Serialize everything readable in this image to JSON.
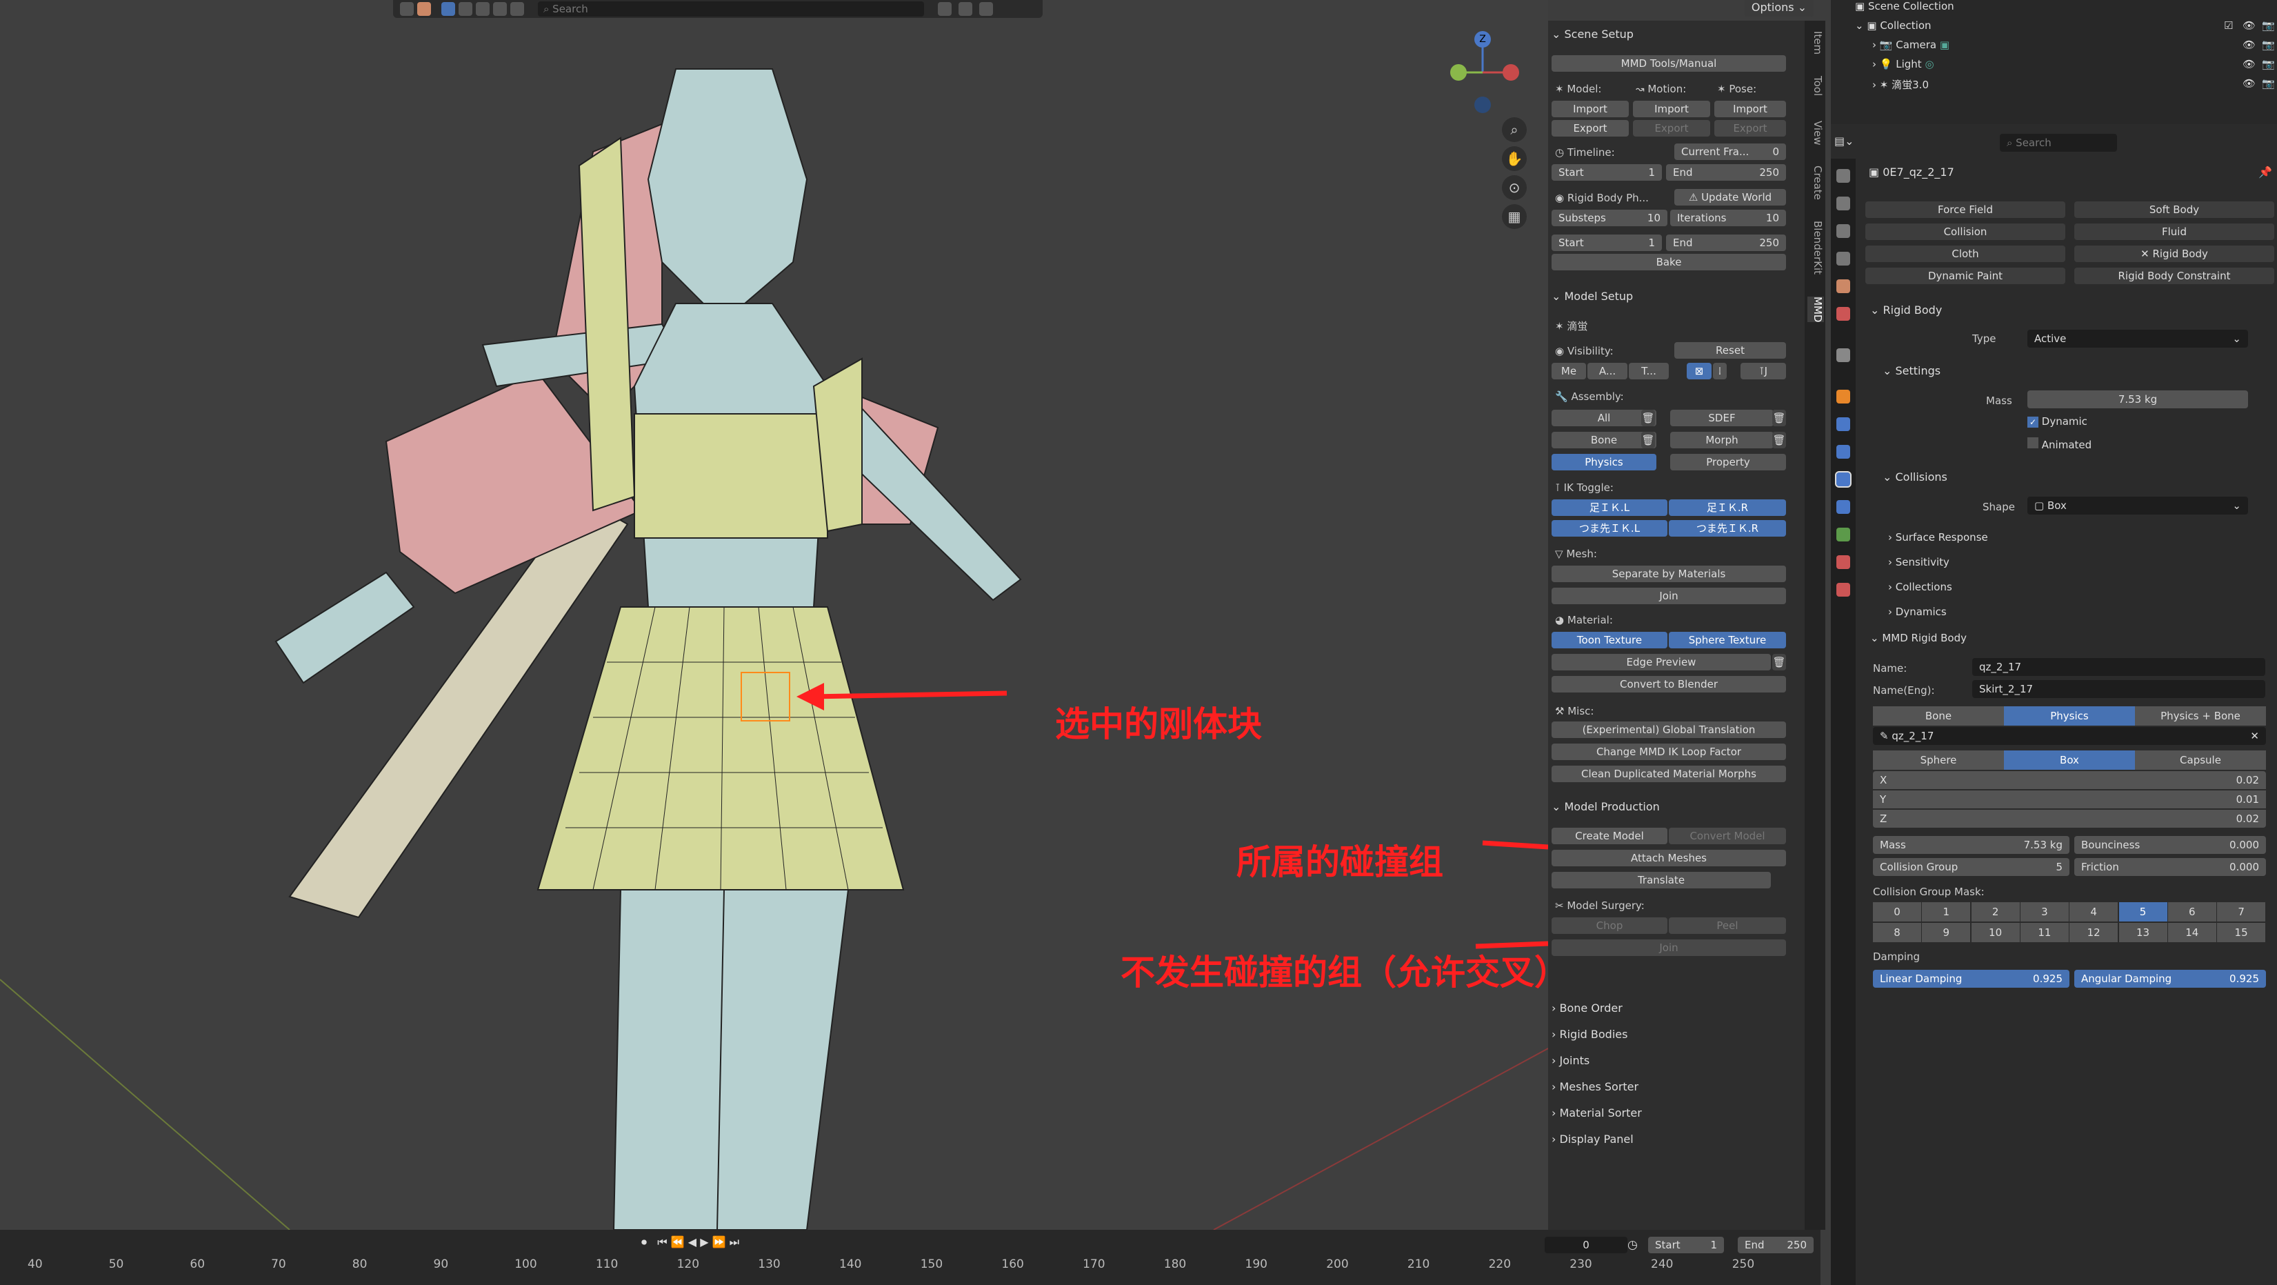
{
  "viewport": {
    "search_placeholder": "Search",
    "options_label": "Options",
    "annotations": {
      "selected": "选中的刚体块",
      "collision_group": "所属的碰撞组",
      "no_collide": "不发生碰撞的组（允许交叉）"
    },
    "gizmo": {
      "z": "Z"
    }
  },
  "timeline": {
    "ticks": [
      "40",
      "50",
      "60",
      "70",
      "80",
      "90",
      "100",
      "110",
      "120",
      "130",
      "140",
      "150",
      "160",
      "170",
      "180",
      "190",
      "200",
      "210",
      "220",
      "230",
      "240",
      "250"
    ],
    "current": "0",
    "start_label": "Start",
    "start": "1",
    "end_label": "End",
    "end": "250"
  },
  "npanel": {
    "tabs": [
      "Item",
      "Tool",
      "View",
      "Create",
      "BlenderKit",
      "MMD"
    ],
    "scene_setup": "Scene Setup",
    "manual": "MMD Tools/Manual",
    "model_lbl": "Model:",
    "motion_lbl": "Motion:",
    "pose_lbl": "Pose:",
    "import": "Import",
    "export": "Export",
    "timeline_lbl": "Timeline:",
    "current_frame": "Current Fra...",
    "current_frame_val": "0",
    "start": "Start",
    "start_val": "1",
    "end": "End",
    "end_val": "250",
    "rigid_body_ph": "Rigid Body Ph...",
    "update_world": "Update World",
    "substeps": "Substeps",
    "substeps_val": "10",
    "iterations": "Iterations",
    "iterations_val": "10",
    "bake": "Bake",
    "model_setup": "Model Setup",
    "model_name": "滴蛍",
    "visibility": "Visibility:",
    "reset": "Reset",
    "vis_items": [
      "Me",
      "A...",
      "T..."
    ],
    "assembly": "Assembly:",
    "all": "All",
    "sdef": "SDEF",
    "bone": "Bone",
    "morph": "Morph",
    "physics": "Physics",
    "property": "Property",
    "ik_toggle": "IK Toggle:",
    "ik": [
      "足ＩＫ.L",
      "足ＩＫ.R",
      "つま先ＩＫ.L",
      "つま先ＩＫ.R"
    ],
    "mesh": "Mesh:",
    "separate": "Separate by Materials",
    "join": "Join",
    "material": "Material:",
    "toon": "Toon Texture",
    "sphere": "Sphere Texture",
    "edge_preview": "Edge Preview",
    "convert_blender": "Convert to Blender",
    "misc": "Misc:",
    "global_translation": "(Experimental) Global Translation",
    "change_ik": "Change MMD IK Loop Factor",
    "clean_morphs": "Clean Duplicated Material Morphs",
    "model_production": "Model Production",
    "create_model": "Create Model",
    "convert_model": "Convert Model",
    "attach_meshes": "Attach Meshes",
    "translate": "Translate",
    "model_surgery": "Model Surgery:",
    "chop": "Chop",
    "peel": "Peel",
    "join2": "Join",
    "bone_order": "Bone Order",
    "rigid_bodies": "Rigid Bodies",
    "joints": "Joints",
    "meshes_sorter": "Meshes Sorter",
    "material_sorter": "Material Sorter",
    "display_panel": "Display Panel"
  },
  "outliner": {
    "scene": "Scene Collection",
    "collection": "Collection",
    "camera": "Camera",
    "light": "Light",
    "model": "滴蛍3.0"
  },
  "properties": {
    "search_placeholder": "Search",
    "object_name": "0E7_qz_2_17",
    "physics_buttons": [
      "Force Field",
      "Soft Body",
      "Collision",
      "Fluid",
      "Cloth",
      "Rigid Body",
      "Dynamic Paint",
      "Rigid Body Constraint"
    ],
    "rigid_body": "Rigid Body",
    "type_lbl": "Type",
    "type_val": "Active",
    "settings": "Settings",
    "mass_lbl": "Mass",
    "mass_val": "7.53 kg",
    "dynamic": "Dynamic",
    "animated": "Animated",
    "collisions": "Collisions",
    "shape_lbl": "Shape",
    "shape_val": "Box",
    "surface_response": "Surface Response",
    "sensitivity": "Sensitivity",
    "collections": "Collections",
    "dynamics": "Dynamics",
    "mmd_rigid": "MMD Rigid Body",
    "name_lbl": "Name:",
    "name_val": "qz_2_17",
    "name_eng_lbl": "Name(Eng):",
    "name_eng_val": "Skirt_2_17",
    "type_tabs": [
      "Bone",
      "Physics",
      "Physics + Bone"
    ],
    "bone_field": "qz_2_17",
    "shape_tabs": [
      "Sphere",
      "Box",
      "Capsule"
    ],
    "x": "X",
    "x_val": "0.02",
    "y": "Y",
    "y_val": "0.01",
    "z": "Z",
    "z_val": "0.02",
    "mass2": "Mass",
    "mass2_val": "7.53 kg",
    "bounciness": "Bounciness",
    "bounciness_val": "0.000",
    "collision_group": "Collision Group",
    "collision_group_val": "5",
    "friction": "Friction",
    "friction_val": "0.000",
    "mask_lbl": "Collision Group Mask:",
    "mask": [
      "0",
      "1",
      "2",
      "3",
      "4",
      "5",
      "6",
      "7",
      "8",
      "9",
      "10",
      "11",
      "12",
      "13",
      "14",
      "15"
    ],
    "damping": "Damping",
    "linear": "Linear Damping",
    "linear_val": "0.925",
    "angular": "Angular Damping",
    "angular_val": "0.925"
  },
  "colors": {
    "accent": "#4772b3",
    "annotation": "#ff2020"
  }
}
